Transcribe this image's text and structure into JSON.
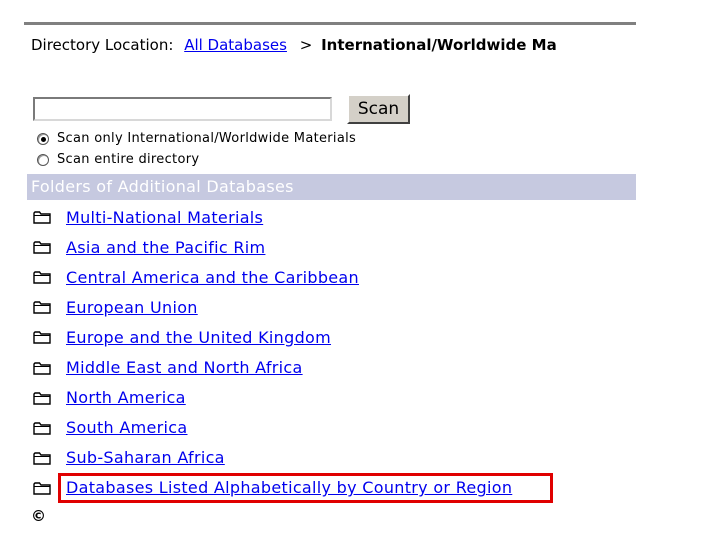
{
  "directory": {
    "label": "Directory Location:",
    "root_link": "All Databases",
    "separator": ">",
    "current": "International/Worldwide Ma"
  },
  "search": {
    "input_value": "",
    "button_label": "Scan",
    "options": [
      {
        "label": "Scan only International/Worldwide Materials",
        "selected": true
      },
      {
        "label": "Scan entire directory",
        "selected": false
      }
    ]
  },
  "folders": {
    "header": "Folders of Additional Databases",
    "items": [
      {
        "label": "Multi-National Materials"
      },
      {
        "label": "Asia and the Pacific Rim"
      },
      {
        "label": "Central America and the Caribbean"
      },
      {
        "label": "European Union"
      },
      {
        "label": "Europe and the United Kingdom"
      },
      {
        "label": "Middle East and North Africa"
      },
      {
        "label": "North America"
      },
      {
        "label": "South America"
      },
      {
        "label": "Sub-Saharan Africa"
      },
      {
        "label": "Databases Listed Alphabetically by Country or Region"
      }
    ],
    "highlighted_index": 9
  },
  "footer": {
    "copyright": "©"
  },
  "colors": {
    "link": "#0000ee",
    "header_bg": "#c6c9e0",
    "highlight": "#e00000"
  },
  "icons": {
    "folder": "folder-icon",
    "radio": "radio-icon"
  }
}
